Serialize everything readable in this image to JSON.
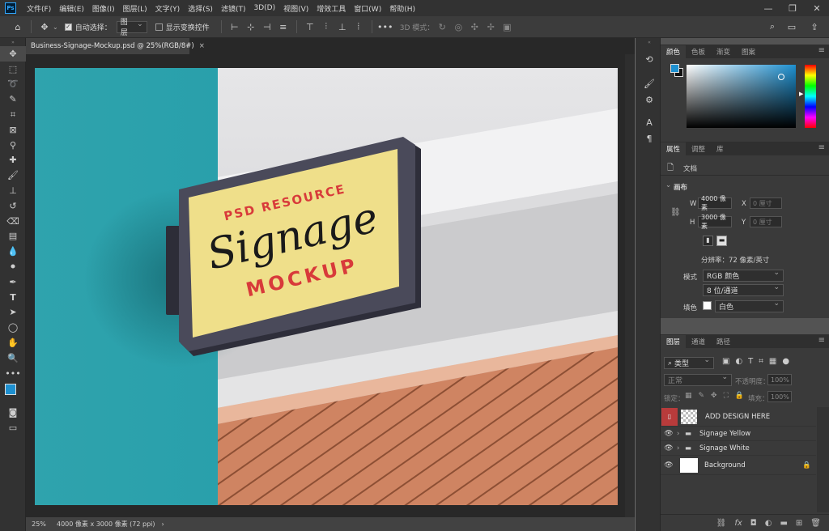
{
  "app": {
    "logo": "Ps"
  },
  "menu": [
    "文件(F)",
    "编辑(E)",
    "图像(I)",
    "图层(L)",
    "文字(Y)",
    "选择(S)",
    "滤镜(T)",
    "3D(D)",
    "视图(V)",
    "增效工具",
    "窗口(W)",
    "帮助(H)"
  ],
  "window_controls": {
    "minimize": "—",
    "maximize": "❐",
    "close": "✕"
  },
  "options": {
    "auto_select_label": "自动选择：",
    "auto_select_value": "图层",
    "show_transform_label": "显示变换控件",
    "mode_3d_label": "3D 模式：",
    "more": "•••"
  },
  "document": {
    "tab_title": "Business-Signage-Mockup.psd @ 25%(RGB/8#)",
    "tab_close": "×",
    "zoom": "25%",
    "status": "4000 像素 x 3000 像素 (72 ppi)",
    "status_arrow": "›"
  },
  "mockup": {
    "line1": "PSD RESOURCE",
    "line2": "Signage",
    "line3": "MOCKUP"
  },
  "color_panel": {
    "tabs": [
      "颜色",
      "色板",
      "渐变",
      "图案"
    ],
    "fg": "#1e90d0",
    "bg": "#111111"
  },
  "properties": {
    "tabs": [
      "属性",
      "调整",
      "库"
    ],
    "doc_label": "文档",
    "canvas_label": "画布",
    "w_label": "W",
    "w_value": "4000 像素",
    "h_label": "H",
    "h_value": "3000 像素",
    "x_label": "X",
    "x_value": "0 厘寸",
    "y_label": "Y",
    "y_value": "0 厘寸",
    "resolution": "分辨率：72 像素/英寸",
    "mode_label": "模式",
    "mode_value": "RGB 颜色",
    "depth_value": "8 位/通道",
    "fill_label": "填色",
    "fill_value": "白色"
  },
  "layers": {
    "tabs": [
      "图层",
      "通道",
      "路径"
    ],
    "filter_kind": "类型",
    "blend_mode": "正常",
    "opacity_label": "不透明度：",
    "opacity_value": "100%",
    "lock_label": "锁定：",
    "fill_label": "填充：",
    "fill_value": "100%",
    "items": [
      {
        "name": "ADD DESIGN HERE",
        "type": "smart"
      },
      {
        "name": "Signage Yellow",
        "type": "group"
      },
      {
        "name": "Signage White",
        "type": "group"
      },
      {
        "name": "Background",
        "type": "background"
      }
    ],
    "footer_icons": [
      "link-icon",
      "fx-icon",
      "mask-icon",
      "adjustment-icon",
      "folder-icon",
      "new-layer-icon",
      "trash-icon"
    ]
  }
}
